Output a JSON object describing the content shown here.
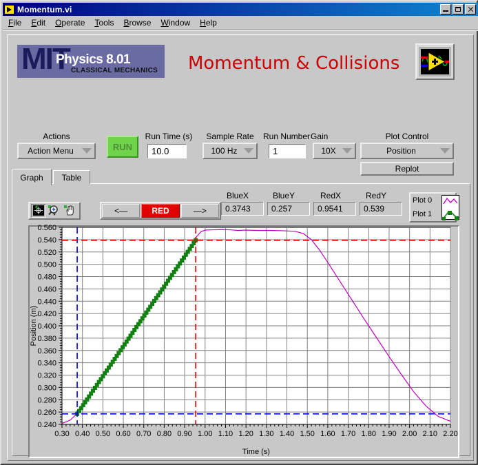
{
  "window": {
    "title": "Momentum.vi",
    "icon": "labview-vi-icon",
    "buttons": {
      "minimize": "minimize",
      "maximize": "maximize",
      "close": "close"
    }
  },
  "menubar": {
    "items": [
      {
        "label": "File",
        "mnemonic": "F"
      },
      {
        "label": "Edit",
        "mnemonic": "E"
      },
      {
        "label": "Operate",
        "mnemonic": "O"
      },
      {
        "label": "Tools",
        "mnemonic": "T"
      },
      {
        "label": "Browse",
        "mnemonic": "B"
      },
      {
        "label": "Window",
        "mnemonic": "W"
      },
      {
        "label": "Help",
        "mnemonic": "H"
      }
    ]
  },
  "header": {
    "logo": {
      "mit": "MIT",
      "course": "Physics 8.01",
      "subtitle": "CLASSICAL MECHANICS"
    },
    "app_title": "Momentum & Collisions",
    "app_title_color": "#cc0000",
    "logo_bg": "#6b6ba3",
    "vi_icon": "labview-logo-icon"
  },
  "controls": {
    "actions": {
      "label": "Actions",
      "value": "Action Menu"
    },
    "run": {
      "label": "RUN"
    },
    "run_time": {
      "label": "Run Time (s)",
      "value": "10.0"
    },
    "sample_rate": {
      "label": "Sample Rate",
      "value": "100 Hz"
    },
    "run_number": {
      "label": "Run Number",
      "value": "1"
    },
    "gain": {
      "label": "Gain",
      "value": "10X"
    },
    "plot_control": {
      "label": "Plot Control",
      "value": "Position"
    },
    "replot": {
      "label": "Replot"
    }
  },
  "tabs": [
    {
      "label": "Graph",
      "active": true
    },
    {
      "label": "Table",
      "active": false
    }
  ],
  "palette": {
    "tools": [
      {
        "name": "cursor-crosshair-tool",
        "selected": true
      },
      {
        "name": "zoom-tool",
        "selected": false
      },
      {
        "name": "pan-hand-tool",
        "selected": false
      }
    ]
  },
  "cursor_nav": {
    "prev": "<—",
    "active_cursor": "RED",
    "next": "—>",
    "active_color": "#e00000"
  },
  "cursor_values": [
    {
      "label": "BlueX",
      "value": "0.3743"
    },
    {
      "label": "BlueY",
      "value": "0.257"
    },
    {
      "label": "RedX",
      "value": "0.9541"
    },
    {
      "label": "RedY",
      "value": "0.539"
    }
  ],
  "legend": {
    "entries": [
      {
        "label": "Plot 0",
        "color": "#c000c0",
        "style": "line"
      },
      {
        "label": "Plot 1",
        "color": "#108010",
        "style": "line-with-square-markers"
      }
    ]
  },
  "chart_data": {
    "type": "line",
    "title": "",
    "xlabel": "Time (s)",
    "ylabel": "Position (m)",
    "xlim": [
      0.3,
      2.2
    ],
    "ylim": [
      0.24,
      0.56
    ],
    "xticks": [
      "0.30",
      "0.40",
      "0.50",
      "0.60",
      "0.70",
      "0.80",
      "0.90",
      "1.00",
      "1.10",
      "1.20",
      "1.30",
      "1.40",
      "1.50",
      "1.60",
      "1.70",
      "1.80",
      "1.90",
      "2.00",
      "2.10",
      "2.20"
    ],
    "yticks": [
      "0.240",
      "0.260",
      "0.280",
      "0.300",
      "0.320",
      "0.340",
      "0.360",
      "0.380",
      "0.400",
      "0.420",
      "0.440",
      "0.460",
      "0.480",
      "0.500",
      "0.520",
      "0.540",
      "0.560"
    ],
    "xtick_step": 0.1,
    "ytick_step": 0.02,
    "minor_ticks_per_major": 5,
    "grid": true,
    "grid_color": "#808080",
    "plot_bg": "#ffffff",
    "legend_position": "top-right-external",
    "series": [
      {
        "name": "Plot 0",
        "color": "#c000c0",
        "style": "line",
        "x": [
          0.3,
          0.34,
          0.38,
          0.42,
          0.46,
          0.5,
          0.54,
          0.58,
          0.62,
          0.66,
          0.7,
          0.74,
          0.78,
          0.82,
          0.86,
          0.9,
          0.94,
          0.96,
          0.98,
          1.0,
          1.04,
          1.08,
          1.12,
          1.16,
          1.2,
          1.26,
          1.32,
          1.38,
          1.44,
          1.48,
          1.52,
          1.56,
          1.6,
          1.66,
          1.72,
          1.78,
          1.84,
          1.9,
          1.96,
          2.02,
          2.08,
          2.14,
          2.2
        ],
        "y": [
          0.2415,
          0.2468,
          0.2595,
          0.279,
          0.2985,
          0.318,
          0.3375,
          0.357,
          0.3765,
          0.396,
          0.4155,
          0.435,
          0.4545,
          0.474,
          0.4935,
          0.513,
          0.535,
          0.5455,
          0.553,
          0.5555,
          0.556,
          0.5565,
          0.556,
          0.555,
          0.5555,
          0.555,
          0.555,
          0.5545,
          0.5535,
          0.55,
          0.54,
          0.523,
          0.503,
          0.472,
          0.441,
          0.41,
          0.38,
          0.35,
          0.321,
          0.293,
          0.27,
          0.253,
          0.245
        ]
      },
      {
        "name": "Plot 1",
        "color": "#108010",
        "style": "line-with-square-markers",
        "description": "fitted/selected linear segment between the blue and red cursors",
        "x": [
          0.3743,
          0.42,
          0.46,
          0.5,
          0.54,
          0.58,
          0.62,
          0.66,
          0.7,
          0.74,
          0.78,
          0.82,
          0.86,
          0.9,
          0.9541
        ],
        "y": [
          0.257,
          0.2795,
          0.299,
          0.3185,
          0.338,
          0.3575,
          0.377,
          0.3965,
          0.416,
          0.4355,
          0.455,
          0.4745,
          0.494,
          0.5135,
          0.539
        ]
      }
    ],
    "cursors": [
      {
        "name": "blue-cursor",
        "color": "#0000d0",
        "x": 0.3743,
        "y": 0.257,
        "style": "dashed-crosshair"
      },
      {
        "name": "red-cursor",
        "color": "#e00000",
        "x": 0.9541,
        "y": 0.539,
        "style": "dashed-crosshair"
      }
    ]
  }
}
